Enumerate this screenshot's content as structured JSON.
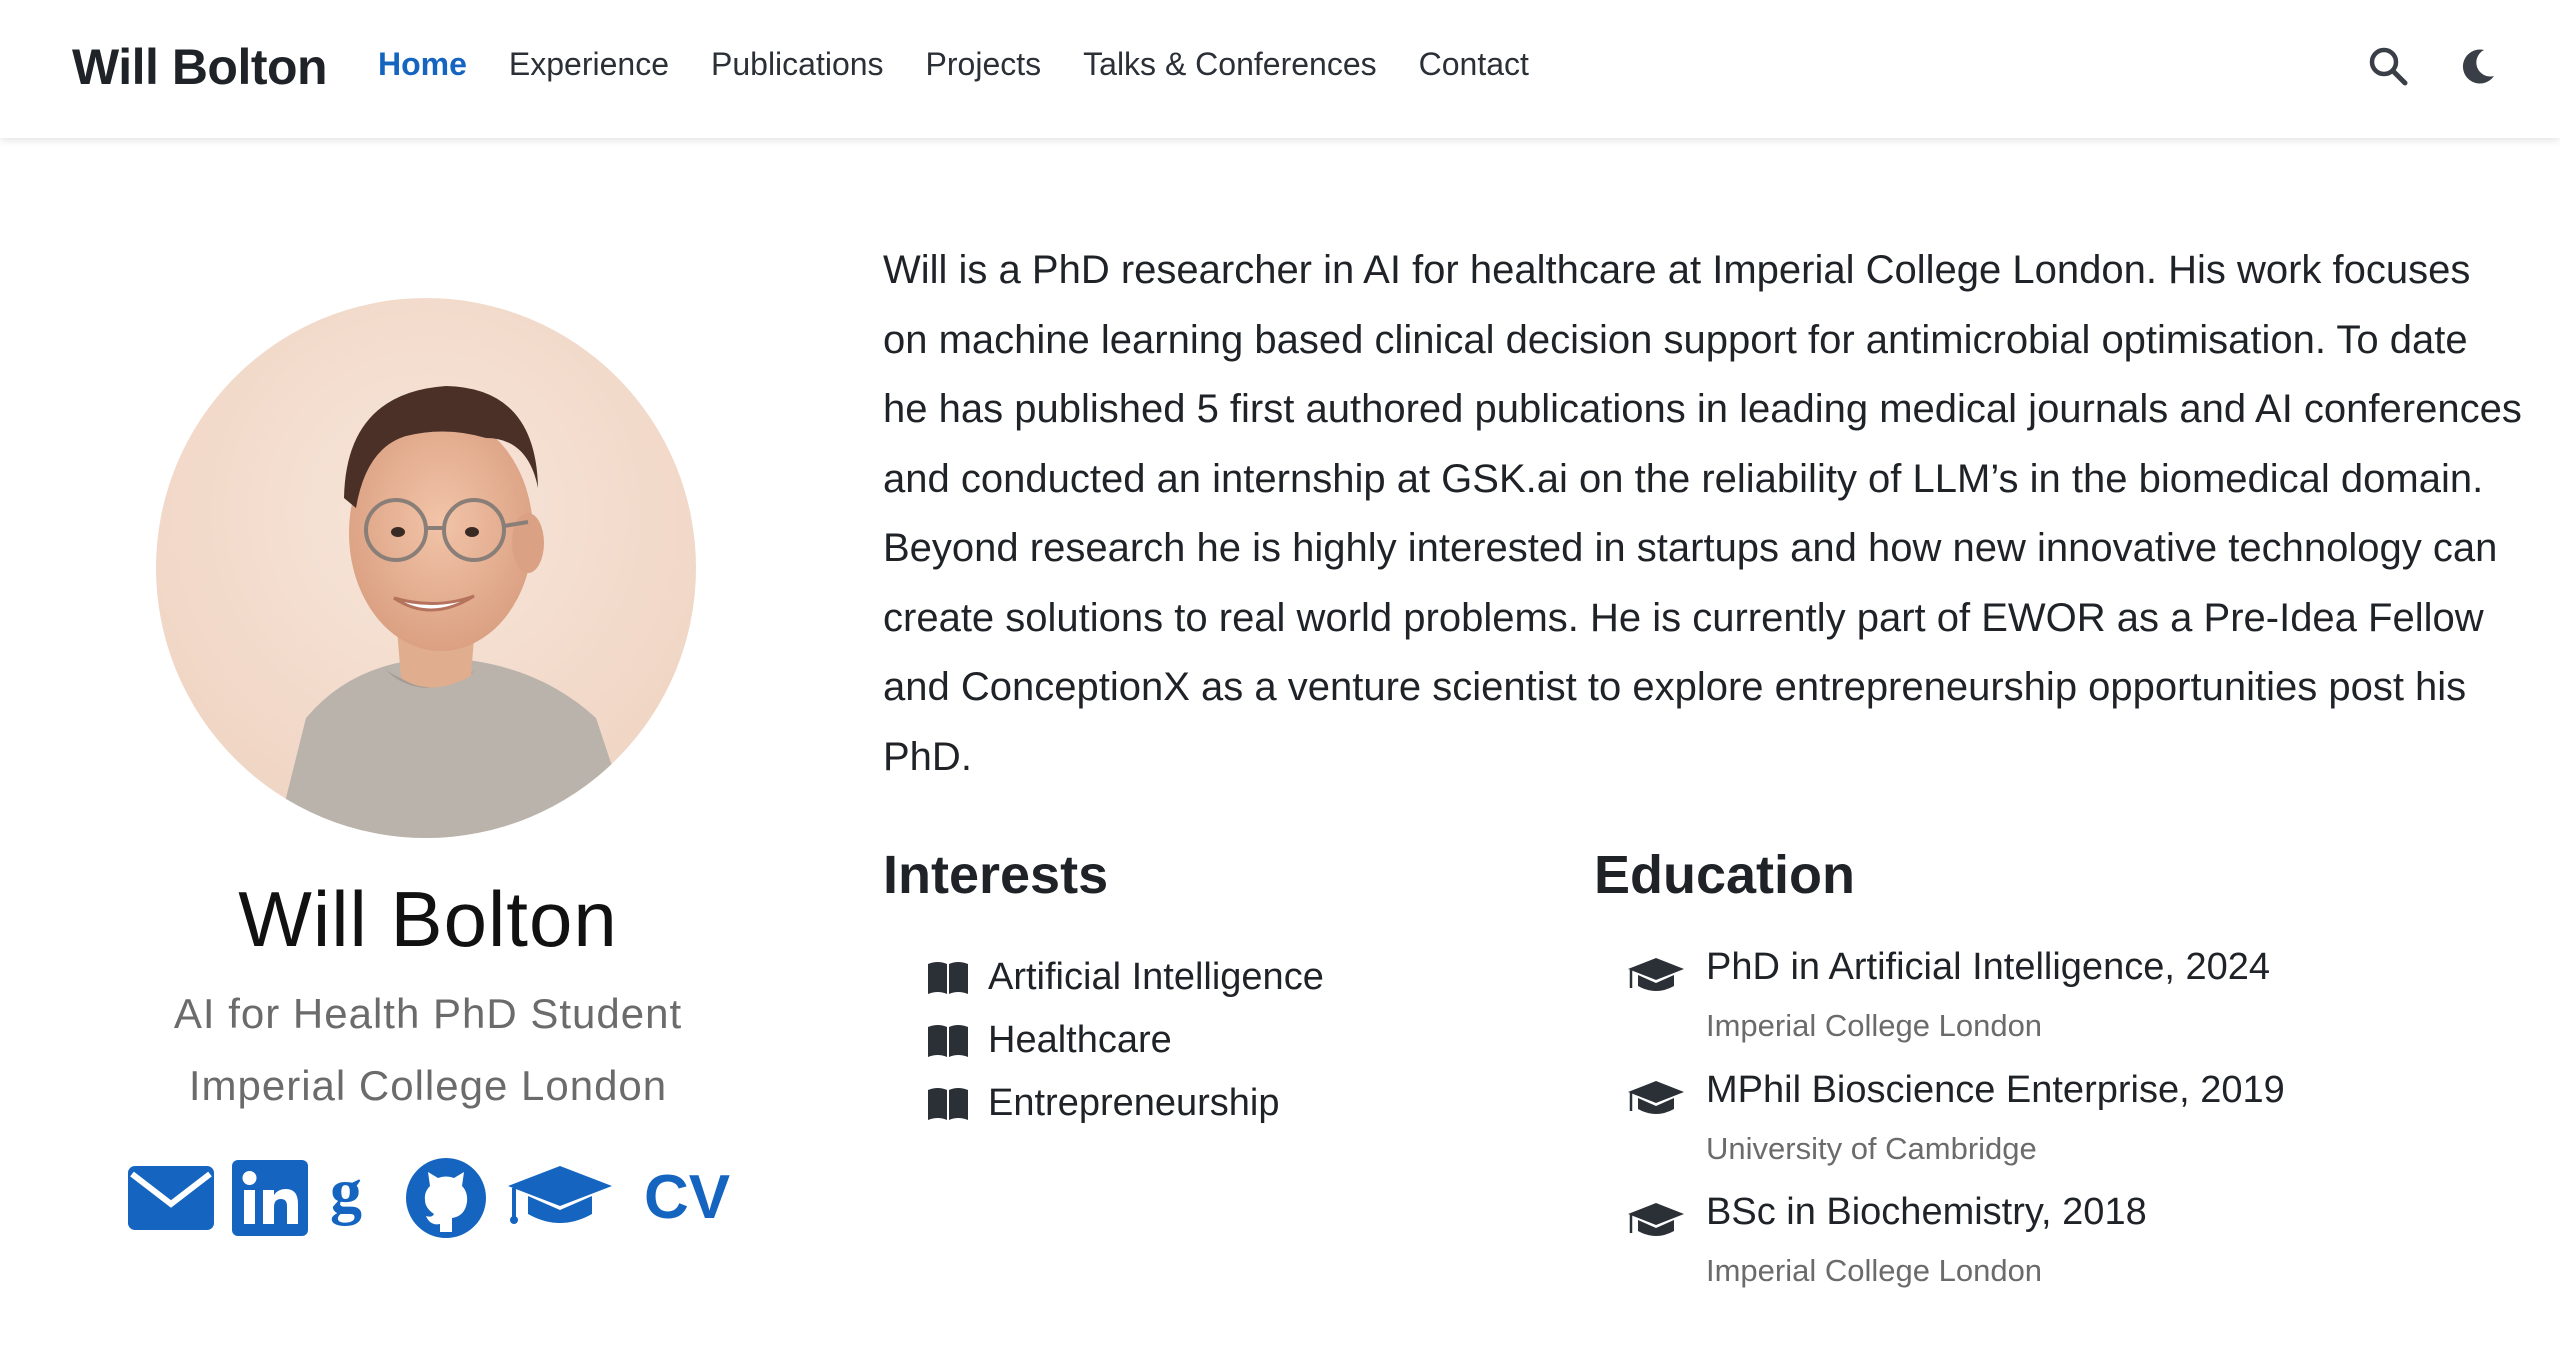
{
  "nav": {
    "brand": "Will Bolton",
    "links": [
      "Home",
      "Experience",
      "Publications",
      "Projects",
      "Talks & Conferences",
      "Contact"
    ],
    "active": "Home",
    "tools": [
      "search-icon",
      "moon-icon"
    ]
  },
  "profile": {
    "name": "Will Bolton",
    "role": "AI for Health PhD Student",
    "organization": "Imperial College London",
    "socials": [
      "envelope-icon",
      "linkedin-icon",
      "google-scholar-icon",
      "github-icon",
      "graduation-cap-icon"
    ],
    "cv_label": "CV"
  },
  "bio": "Will is a PhD researcher in AI for healthcare at Imperial College London. His work focuses on machine learning based clinical decision support for antimicrobial optimisation. To date he has published 5 first authored publications in leading medical journals and AI conferences and conducted an internship at GSK.ai on the reliability of LLM’s in the biomedical domain. Beyond research he is highly interested in startups and how new innovative technology can create solutions to real world problems. He is currently part of EWOR as a Pre-Idea Fellow and ConceptionX as a venture scientist to explore entrepreneurship opportunities post his PhD.",
  "interests": {
    "title": "Interests",
    "items": [
      "Artificial Intelligence",
      "Healthcare",
      "Entrepreneurship"
    ]
  },
  "education": {
    "title": "Education",
    "items": [
      {
        "course": "PhD in Artificial Intelligence, 2024",
        "institution": "Imperial College London"
      },
      {
        "course": "MPhil Bioscience Enterprise, 2019",
        "institution": "University of Cambridge"
      },
      {
        "course": "BSc in Biochemistry, 2018",
        "institution": "Imperial College London"
      }
    ]
  },
  "colors": {
    "accent": "#1565c0",
    "text": "#1f2328",
    "muted": "#6b6b6b"
  }
}
